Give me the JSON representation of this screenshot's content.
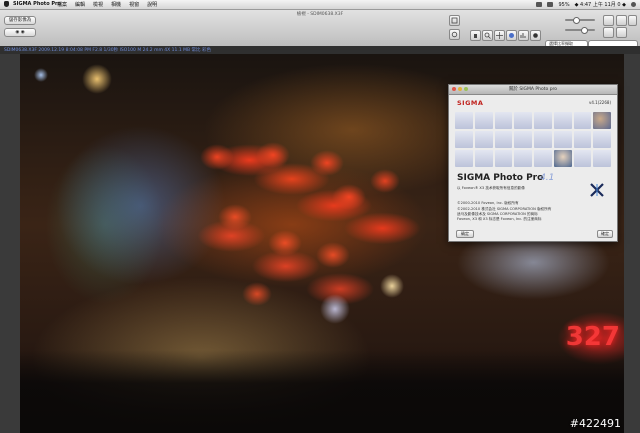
{
  "menubar": {
    "app_name": "SIGMA Photo Pro",
    "menus": [
      "檔案",
      "編輯",
      "檢視",
      "相機",
      "視窗",
      "說明"
    ],
    "clock": "◆ 4:47 上午 11月 0 ◆",
    "battery": "95%"
  },
  "window": {
    "title": "檢視 - SDIM0638.X3F",
    "button_left": "儲存影像為",
    "button_left2": "◉ ◉"
  },
  "toolbar": {
    "search_placeholder": "選擇比率擷取"
  },
  "infobar": {
    "text": "SDIM0638.X3F  2009.12.19 8:04:08 PM  F2.8  1/30秒  ISO100  M 24.2 mm  4X  11.1 MB  常比  彩色"
  },
  "photo": {
    "sign_text": "327",
    "watermark": "#422491"
  },
  "about": {
    "title": "關於 SIGMA Photo pro",
    "brand": "SIGMA",
    "version_small": "v4.1(2268)",
    "product_name": "SIGMA Photo Pro",
    "product_version": "4.1",
    "line1": "以 Foveon® X3 技术获取所有信息的影像",
    "line2": "©2000-2010 Foveon, Inc. 版权所有",
    "line3": "©2002-2010 株式会社 SIGMA CORPORATION 版权所有",
    "line4": "适马及影像技术及 SIGMA CORPORATION 的商标",
    "line5": "Foveon, X3 和 X3 标志是 Foveon, Inc. 的注册商标",
    "button_left": "确定",
    "button_right": "確定"
  },
  "colors": {
    "logo_red": "#c0221d",
    "version_blue": "#8aa0d8",
    "infobar_text": "#6d8ad6",
    "sign_red": "#ff3a3a"
  }
}
